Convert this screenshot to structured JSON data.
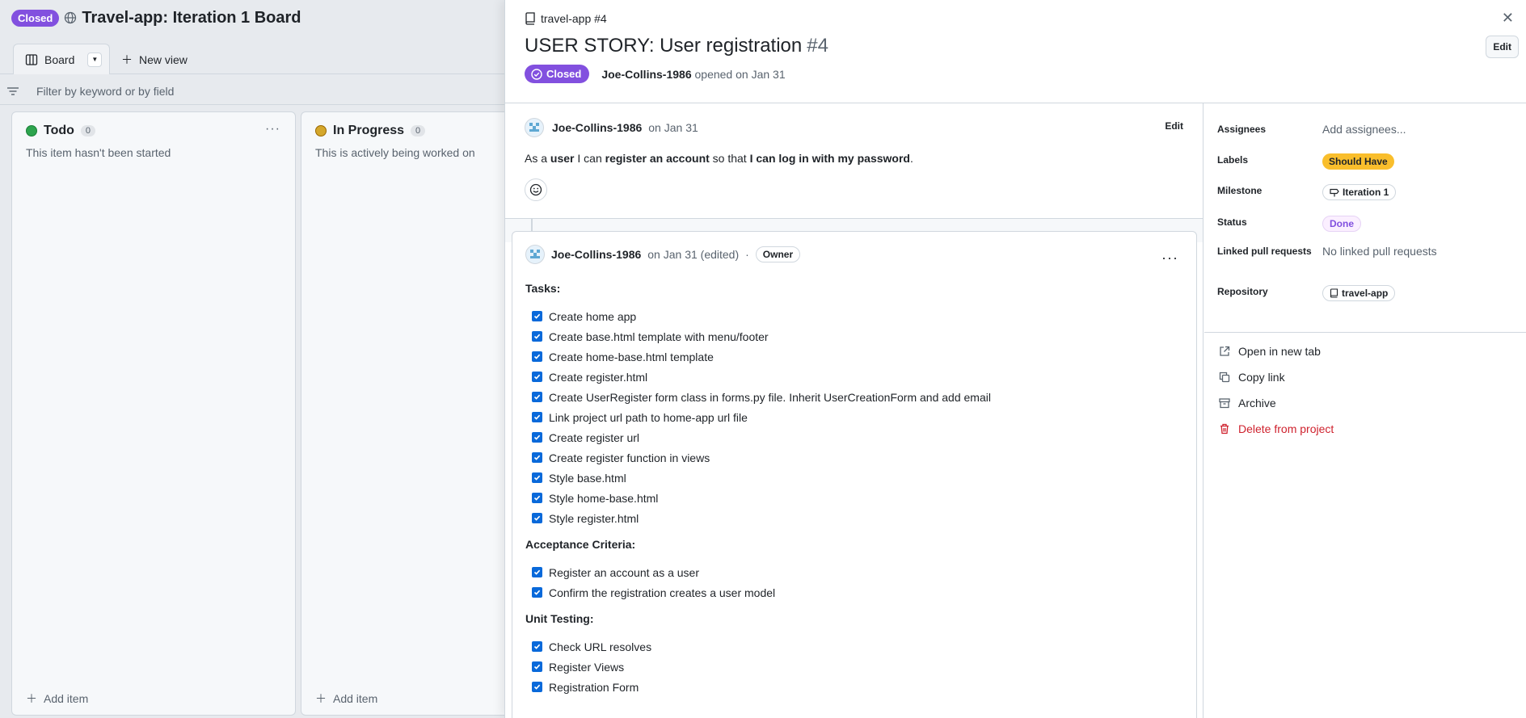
{
  "board": {
    "status_badge": "Closed",
    "title": "Travel-app: Iteration 1 Board",
    "view_tab": "Board",
    "new_view": "New view",
    "filter_placeholder": "Filter by keyword or by field",
    "columns": [
      {
        "name": "Todo",
        "count": "0",
        "description": "This item hasn't been started",
        "dot_color": "#2da44e",
        "add_item": "Add item"
      },
      {
        "name": "In Progress",
        "count": "0",
        "description": "This is actively being worked on",
        "dot_color": "#bf8700",
        "add_item": "Add item"
      }
    ]
  },
  "panel": {
    "repo_ref": "travel-app #4",
    "title": "USER STORY: User registration",
    "number": "#4",
    "state": "Closed",
    "author": "Joe-Collins-1986",
    "opened_text": "opened on Jan 31",
    "edit_label": "Edit",
    "description": {
      "author": "Joe-Collins-1986",
      "date": "on Jan 31",
      "edit_label": "Edit",
      "body": {
        "p1": "As a ",
        "b1": "user",
        "p2": " I can ",
        "b2": "register an account",
        "p3": " so that ",
        "b3": "I can log in with my password",
        "p4": "."
      }
    },
    "comment": {
      "author": "Joe-Collins-1986",
      "date": "on Jan 31 (edited)",
      "separator": "·",
      "role": "Owner",
      "sections": [
        {
          "title": "Tasks:",
          "items": [
            "Create home app",
            "Create base.html template with menu/footer",
            "Create home-base.html template",
            "Create register.html",
            "Create UserRegister form class in forms.py file. Inherit UserCreationForm and add email",
            "Link project url path to home-app url file",
            "Create register url",
            "Create register function in views",
            "Style base.html",
            "Style home-base.html",
            "Style register.html"
          ]
        },
        {
          "title": "Acceptance Criteria:",
          "items": [
            "Register an account as a user",
            "Confirm the registration creates a user model"
          ]
        },
        {
          "title": "Unit Testing:",
          "items": [
            "Check URL resolves",
            "Register Views",
            "Registration Form"
          ]
        }
      ]
    },
    "sidebar": {
      "assignees_label": "Assignees",
      "assignees_value": "Add assignees...",
      "labels_label": "Labels",
      "label_value": "Should Have",
      "milestone_label": "Milestone",
      "milestone_value": "Iteration 1",
      "status_label": "Status",
      "status_value": "Done",
      "linked_label": "Linked pull requests",
      "linked_value": "No linked pull requests",
      "repository_label": "Repository",
      "repository_value": "travel-app",
      "actions": {
        "open_new_tab": "Open in new tab",
        "copy_link": "Copy link",
        "archive": "Archive",
        "delete": "Delete from project"
      }
    }
  }
}
